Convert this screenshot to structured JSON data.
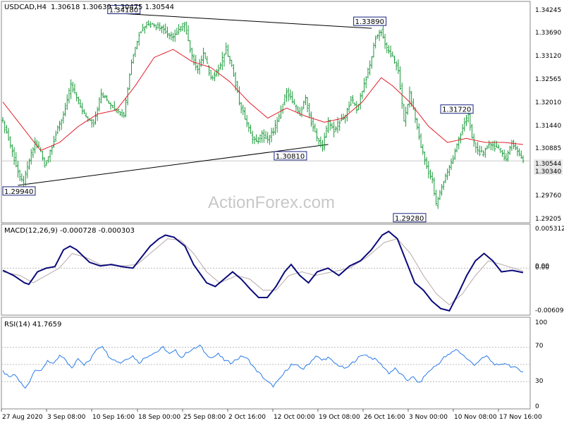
{
  "header": {
    "symbol": "USDCAD,H4",
    "ohlc": "1.30618 1.30639 1.30475 1.30544",
    "macd": "MACD(12,26,9) -0.000728 -0.000303",
    "rsi": "RSI(14) 41.7659"
  },
  "watermark": "ActionForex.com",
  "colors": {
    "bars": "#1a9a3a",
    "ma": "#e0202a",
    "macd": "#0a0a7a",
    "signal": "#b8a8a8",
    "rsi": "#2a7be8",
    "trendline": "#000000",
    "level": "#c8c8c8"
  },
  "chart_data": [
    {
      "type": "ohlc",
      "name": "USDCAD,H4",
      "ylim": [
        1.2905,
        1.3445
      ],
      "price_ticks": [
        "1.34245",
        "1.33690",
        "1.33120",
        "1.32565",
        "1.32010",
        "1.31440",
        "1.30885",
        "1.30544",
        "1.30340",
        "1.29760",
        "1.29205"
      ],
      "x_tick_labels": [
        "27 Aug 2020",
        "3 Sep 08:00",
        "10 Sep 16:00",
        "18 Sep 00:00",
        "25 Sep 08:00",
        "2 Oct 16:00",
        "12 Oct 00:00",
        "19 Oct 08:00",
        "26 Oct 16:00",
        "3 Nov 00:00",
        "10 Nov 08:00",
        "17 Nov 16:00"
      ],
      "annotations": [
        "1.34180",
        "1.33890",
        "1.31720",
        "1.30810",
        "1.29940",
        "1.29280"
      ],
      "close_anchors": [
        [
          0,
          1.315
        ],
        [
          3,
          1.311
        ],
        [
          6,
          1.306
        ],
        [
          9,
          1.301
        ],
        [
          11,
          1.3
        ],
        [
          14,
          1.3055
        ],
        [
          17,
          1.31
        ],
        [
          20,
          1.308
        ],
        [
          22,
          1.304
        ],
        [
          25,
          1.308
        ],
        [
          28,
          1.312
        ],
        [
          32,
          1.317
        ],
        [
          36,
          1.324
        ],
        [
          40,
          1.32
        ],
        [
          44,
          1.316
        ],
        [
          48,
          1.315
        ],
        [
          52,
          1.322
        ],
        [
          56,
          1.32
        ],
        [
          60,
          1.318
        ],
        [
          64,
          1.317
        ],
        [
          68,
          1.33
        ],
        [
          72,
          1.337
        ],
        [
          76,
          1.3395
        ],
        [
          80,
          1.339
        ],
        [
          84,
          1.3385
        ],
        [
          88,
          1.336
        ],
        [
          92,
          1.337
        ],
        [
          96,
          1.3395
        ],
        [
          100,
          1.331
        ],
        [
          103,
          1.328
        ],
        [
          106,
          1.332
        ],
        [
          110,
          1.326
        ],
        [
          114,
          1.328
        ],
        [
          118,
          1.333
        ],
        [
          122,
          1.327
        ],
        [
          125,
          1.32
        ],
        [
          128,
          1.316
        ],
        [
          131,
          1.312
        ],
        [
          134,
          1.31
        ],
        [
          137,
          1.312
        ],
        [
          140,
          1.3105
        ],
        [
          143,
          1.313
        ],
        [
          146,
          1.316
        ],
        [
          150,
          1.323
        ],
        [
          153,
          1.32
        ],
        [
          157,
          1.317
        ],
        [
          160,
          1.321
        ],
        [
          163,
          1.315
        ],
        [
          166,
          1.311
        ],
        [
          169,
          1.309
        ],
        [
          172,
          1.315
        ],
        [
          175,
          1.313
        ],
        [
          178,
          1.315
        ],
        [
          181,
          1.3165
        ],
        [
          184,
          1.321
        ],
        [
          187,
          1.318
        ],
        [
          190,
          1.323
        ],
        [
          194,
          1.329
        ],
        [
          197,
          1.336
        ],
        [
          200,
          1.3375
        ],
        [
          203,
          1.333
        ],
        [
          206,
          1.331
        ],
        [
          209,
          1.328
        ],
        [
          212,
          1.315
        ],
        [
          215,
          1.322
        ],
        [
          218,
          1.316
        ],
        [
          221,
          1.309
        ],
        [
          224,
          1.304
        ],
        [
          227,
          1.3005
        ],
        [
          229,
          1.2945
        ],
        [
          232,
          1.299
        ],
        [
          235,
          1.303
        ],
        [
          238,
          1.306
        ],
        [
          241,
          1.311
        ],
        [
          244,
          1.315
        ],
        [
          246,
          1.3165
        ],
        [
          248,
          1.311
        ],
        [
          251,
          1.308
        ],
        [
          254,
          1.307
        ],
        [
          257,
          1.31
        ],
        [
          260,
          1.309
        ],
        [
          263,
          1.308
        ],
        [
          266,
          1.306
        ],
        [
          269,
          1.31
        ],
        [
          272,
          1.308
        ],
        [
          275,
          1.3055
        ]
      ],
      "ma_anchors": [
        [
          0,
          1.32
        ],
        [
          10,
          1.314
        ],
        [
          20,
          1.308
        ],
        [
          30,
          1.31
        ],
        [
          40,
          1.314
        ],
        [
          50,
          1.317
        ],
        [
          60,
          1.318
        ],
        [
          70,
          1.324
        ],
        [
          80,
          1.331
        ],
        [
          90,
          1.333
        ],
        [
          100,
          1.33
        ],
        [
          110,
          1.3285
        ],
        [
          120,
          1.325
        ],
        [
          130,
          1.32
        ],
        [
          140,
          1.316
        ],
        [
          150,
          1.3185
        ],
        [
          160,
          1.3165
        ],
        [
          170,
          1.315
        ],
        [
          180,
          1.316
        ],
        [
          190,
          1.32
        ],
        [
          200,
          1.326
        ],
        [
          206,
          1.324
        ],
        [
          215,
          1.32
        ],
        [
          225,
          1.314
        ],
        [
          235,
          1.31
        ],
        [
          245,
          1.311
        ],
        [
          255,
          1.31
        ],
        [
          265,
          1.31
        ],
        [
          275,
          1.3095
        ]
      ],
      "trendlines": [
        {
          "from": [
            65,
            1.3418
          ],
          "to": [
            195,
            1.3382
          ]
        },
        {
          "from": [
            8,
            1.2994
          ],
          "to": [
            172,
            1.3095
          ]
        }
      ],
      "levels": [
        1.30544
      ]
    },
    {
      "type": "line",
      "name": "MACD(12,26,9)",
      "ylim": [
        -0.0063,
        0.0056
      ],
      "ticks": [
        "0.005312",
        "0.00",
        "0.00",
        "-0.006092"
      ],
      "macd_anchors": [
        [
          0,
          -0.0003
        ],
        [
          5,
          -0.001
        ],
        [
          10,
          -0.002
        ],
        [
          12,
          -0.0022
        ],
        [
          16,
          -0.0005
        ],
        [
          20,
          0.0
        ],
        [
          24,
          0.0002
        ],
        [
          28,
          0.0025
        ],
        [
          31,
          0.003
        ],
        [
          34,
          0.0025
        ],
        [
          40,
          0.0008
        ],
        [
          45,
          0.0003
        ],
        [
          50,
          0.0005
        ],
        [
          55,
          0.0002
        ],
        [
          60,
          0.0
        ],
        [
          64,
          0.0015
        ],
        [
          68,
          0.003
        ],
        [
          72,
          0.004
        ],
        [
          75,
          0.0045
        ],
        [
          79,
          0.0042
        ],
        [
          84,
          0.003
        ],
        [
          88,
          0.0005
        ],
        [
          94,
          -0.002
        ],
        [
          98,
          -0.0025
        ],
        [
          102,
          -0.0015
        ],
        [
          106,
          -0.0005
        ],
        [
          110,
          -0.0015
        ],
        [
          114,
          -0.0028
        ],
        [
          118,
          -0.004
        ],
        [
          122,
          -0.004
        ],
        [
          126,
          -0.0025
        ],
        [
          130,
          -0.0005
        ],
        [
          133,
          0.0005
        ],
        [
          137,
          -0.001
        ],
        [
          141,
          -0.002
        ],
        [
          145,
          -0.0005
        ],
        [
          150,
          0.0
        ],
        [
          155,
          -0.001
        ],
        [
          160,
          0.0003
        ],
        [
          165,
          0.001
        ],
        [
          170,
          0.0025
        ],
        [
          175,
          0.0045
        ],
        [
          178,
          0.005
        ],
        [
          182,
          0.004
        ],
        [
          186,
          0.001
        ],
        [
          190,
          -0.002
        ],
        [
          194,
          -0.003
        ],
        [
          198,
          -0.0045
        ],
        [
          202,
          -0.0055
        ],
        [
          206,
          -0.0058
        ],
        [
          210,
          -0.0035
        ],
        [
          214,
          -0.001
        ],
        [
          218,
          0.001
        ],
        [
          222,
          0.002
        ],
        [
          226,
          0.001
        ],
        [
          230,
          -0.0005
        ],
        [
          235,
          -0.0003
        ],
        [
          240,
          -0.0006
        ]
      ],
      "signal_anchors": [
        [
          0,
          -0.0005
        ],
        [
          8,
          -0.001
        ],
        [
          14,
          -0.002
        ],
        [
          20,
          -0.001
        ],
        [
          26,
          0.0
        ],
        [
          32,
          0.002
        ],
        [
          38,
          0.0015
        ],
        [
          45,
          0.0005
        ],
        [
          55,
          0.0003
        ],
        [
          62,
          0.0005
        ],
        [
          70,
          0.0025
        ],
        [
          76,
          0.004
        ],
        [
          82,
          0.0038
        ],
        [
          88,
          0.002
        ],
        [
          94,
          -0.0005
        ],
        [
          100,
          -0.002
        ],
        [
          108,
          -0.001
        ],
        [
          114,
          -0.0015
        ],
        [
          120,
          -0.003
        ],
        [
          126,
          -0.003
        ],
        [
          132,
          -0.001
        ],
        [
          138,
          -0.0005
        ],
        [
          144,
          -0.001
        ],
        [
          152,
          -0.0005
        ],
        [
          160,
          0.0
        ],
        [
          168,
          0.0015
        ],
        [
          176,
          0.0035
        ],
        [
          182,
          0.004
        ],
        [
          188,
          0.002
        ],
        [
          194,
          -0.001
        ],
        [
          200,
          -0.0035
        ],
        [
          206,
          -0.005
        ],
        [
          212,
          -0.0035
        ],
        [
          218,
          -0.001
        ],
        [
          224,
          0.001
        ],
        [
          230,
          0.0005
        ],
        [
          240,
          -0.0004
        ]
      ]
    },
    {
      "type": "line",
      "name": "RSI(14)",
      "ylim": [
        0,
        100
      ],
      "ticks": [
        "100",
        "70",
        "30",
        "0"
      ],
      "levels": [
        70,
        50,
        30
      ],
      "anchors": [
        [
          0,
          42
        ],
        [
          3,
          35
        ],
        [
          6,
          38
        ],
        [
          9,
          28
        ],
        [
          11,
          22
        ],
        [
          13,
          30
        ],
        [
          16,
          45
        ],
        [
          19,
          42
        ],
        [
          22,
          55
        ],
        [
          25,
          50
        ],
        [
          28,
          60
        ],
        [
          31,
          55
        ],
        [
          34,
          45
        ],
        [
          37,
          58
        ],
        [
          40,
          50
        ],
        [
          43,
          55
        ],
        [
          46,
          68
        ],
        [
          49,
          72
        ],
        [
          52,
          60
        ],
        [
          55,
          55
        ],
        [
          58,
          52
        ],
        [
          61,
          57
        ],
        [
          64,
          60
        ],
        [
          67,
          52
        ],
        [
          70,
          58
        ],
        [
          73,
          62
        ],
        [
          76,
          65
        ],
        [
          79,
          70
        ],
        [
          82,
          62
        ],
        [
          85,
          66
        ],
        [
          88,
          58
        ],
        [
          91,
          65
        ],
        [
          94,
          68
        ],
        [
          97,
          72
        ],
        [
          100,
          62
        ],
        [
          103,
          58
        ],
        [
          106,
          62
        ],
        [
          109,
          55
        ],
        [
          112,
          52
        ],
        [
          115,
          56
        ],
        [
          118,
          60
        ],
        [
          121,
          55
        ],
        [
          124,
          45
        ],
        [
          127,
          38
        ],
        [
          130,
          30
        ],
        [
          133,
          25
        ],
        [
          136,
          32
        ],
        [
          139,
          42
        ],
        [
          142,
          50
        ],
        [
          145,
          48
        ],
        [
          148,
          45
        ],
        [
          151,
          52
        ],
        [
          154,
          60
        ],
        [
          157,
          55
        ],
        [
          160,
          58
        ],
        [
          163,
          52
        ],
        [
          166,
          48
        ],
        [
          169,
          45
        ],
        [
          172,
          52
        ],
        [
          175,
          58
        ],
        [
          178,
          62
        ],
        [
          181,
          58
        ],
        [
          184,
          55
        ],
        [
          187,
          48
        ],
        [
          190,
          40
        ],
        [
          193,
          45
        ],
        [
          196,
          38
        ],
        [
          199,
          32
        ],
        [
          202,
          35
        ],
        [
          205,
          28
        ],
        [
          208,
          38
        ],
        [
          211,
          45
        ],
        [
          214,
          50
        ],
        [
          217,
          58
        ],
        [
          220,
          62
        ],
        [
          223,
          68
        ],
        [
          226,
          62
        ],
        [
          229,
          55
        ],
        [
          232,
          50
        ],
        [
          235,
          55
        ],
        [
          238,
          60
        ],
        [
          241,
          52
        ],
        [
          244,
          48
        ],
        [
          247,
          52
        ],
        [
          250,
          48
        ],
        [
          253,
          45
        ],
        [
          256,
          42
        ]
      ]
    }
  ]
}
